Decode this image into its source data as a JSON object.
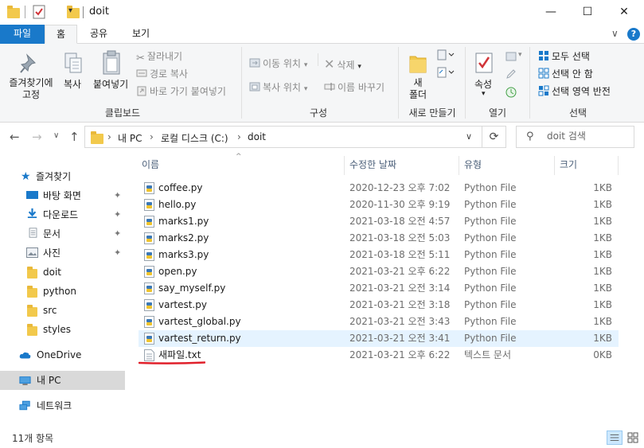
{
  "titlebar": {
    "title": "doit",
    "min_icon": "minimize-icon",
    "max_icon": "maximize-icon",
    "close_icon": "close-icon",
    "min_glyph": "—",
    "max_glyph": "☐",
    "close_glyph": "✕"
  },
  "ribbon_tabs": {
    "file": "파일",
    "home": "홈",
    "share": "공유",
    "view": "보기",
    "collapse_glyph": "∨",
    "help_glyph": "?"
  },
  "ribbon": {
    "clipboard": {
      "pin": "즐겨찾기에 고정",
      "pin_line1": "즐겨찾기에",
      "pin_line2": "고정",
      "copy": "복사",
      "paste": "붙여넣기",
      "cut": "잘라내기",
      "copy_path": "경로 복사",
      "paste_shortcut": "바로 가기 붙여넣기",
      "group_label": "클립보드"
    },
    "organize": {
      "move_to": "이동 위치",
      "copy_to": "복사 위치",
      "delete": "삭제",
      "rename": "이름 바꾸기",
      "group_label": "구성"
    },
    "new": {
      "new_folder_line1": "새",
      "new_folder_line2": "폴더",
      "group_label": "새로 만들기"
    },
    "open": {
      "properties": "속성",
      "group_label": "열기"
    },
    "select": {
      "select_all": "모두 선택",
      "select_none": "선택 안 함",
      "invert": "선택 영역 반전",
      "group_label": "선택"
    }
  },
  "address": {
    "segments": [
      "내 PC",
      "로컬 디스크 (C:)",
      "doit"
    ],
    "separator": "›",
    "dropdown_glyph": "∨",
    "refresh_glyph": "⟳"
  },
  "nav": {
    "back_glyph": "←",
    "forward_glyph": "→",
    "recent_glyph": "∨",
    "up_glyph": "↑"
  },
  "search": {
    "placeholder": "doit 검색",
    "icon_glyph": "⚲"
  },
  "sidebar": {
    "quick_access": "즐겨찾기",
    "items": [
      {
        "label": "바탕 화면",
        "pinned": true
      },
      {
        "label": "다운로드",
        "pinned": true
      },
      {
        "label": "문서",
        "pinned": true
      },
      {
        "label": "사진",
        "pinned": true
      },
      {
        "label": "doit",
        "pinned": false
      },
      {
        "label": "python",
        "pinned": false
      },
      {
        "label": "src",
        "pinned": false
      },
      {
        "label": "styles",
        "pinned": false
      }
    ],
    "onedrive": "OneDrive",
    "this_pc": "내 PC",
    "network": "네트워크",
    "pin_glyph": "📌"
  },
  "columns": {
    "name": "이름",
    "date": "수정한 날짜",
    "type": "유형",
    "size": "크기",
    "sort_glyph": "^"
  },
  "files": [
    {
      "name": "coffee.py",
      "date": "2020-12-23 오후 7:02",
      "type": "Python File",
      "size": "1KB",
      "icon": "python-file-icon"
    },
    {
      "name": "hello.py",
      "date": "2020-11-30 오후 9:19",
      "type": "Python File",
      "size": "1KB",
      "icon": "python-file-icon"
    },
    {
      "name": "marks1.py",
      "date": "2021-03-18 오전 4:57",
      "type": "Python File",
      "size": "1KB",
      "icon": "python-file-icon"
    },
    {
      "name": "marks2.py",
      "date": "2021-03-18 오전 5:03",
      "type": "Python File",
      "size": "1KB",
      "icon": "python-file-icon"
    },
    {
      "name": "marks3.py",
      "date": "2021-03-18 오전 5:11",
      "type": "Python File",
      "size": "1KB",
      "icon": "python-file-icon"
    },
    {
      "name": "open.py",
      "date": "2021-03-21 오후 6:22",
      "type": "Python File",
      "size": "1KB",
      "icon": "python-file-icon"
    },
    {
      "name": "say_myself.py",
      "date": "2021-03-21 오전 3:14",
      "type": "Python File",
      "size": "1KB",
      "icon": "python-file-icon"
    },
    {
      "name": "vartest.py",
      "date": "2021-03-21 오전 3:18",
      "type": "Python File",
      "size": "1KB",
      "icon": "python-file-icon"
    },
    {
      "name": "vartest_global.py",
      "date": "2021-03-21 오전 3:43",
      "type": "Python File",
      "size": "1KB",
      "icon": "python-file-icon"
    },
    {
      "name": "vartest_return.py",
      "date": "2021-03-21 오전 3:41",
      "type": "Python File",
      "size": "1KB",
      "icon": "python-file-icon"
    },
    {
      "name": "새파일.txt",
      "date": "2021-03-21 오후 6:22",
      "type": "텍스트 문서",
      "size": "0KB",
      "icon": "text-file-icon"
    }
  ],
  "status": {
    "item_count": "11개 항목"
  },
  "colors": {
    "accent": "#1979ca",
    "selection": "#e5f3ff",
    "sidebar_selected": "#d9d9d9",
    "annotation": "#e0202b"
  }
}
